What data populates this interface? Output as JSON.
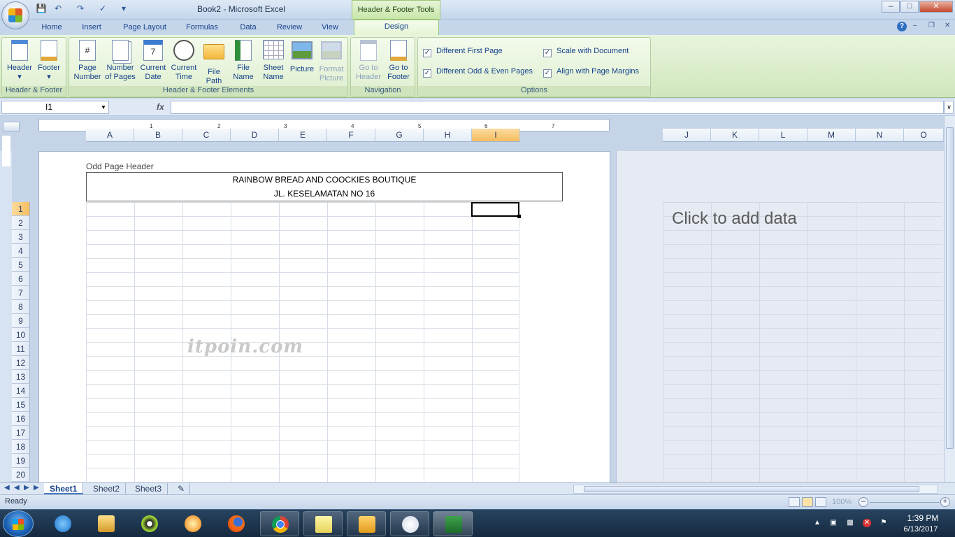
{
  "window": {
    "title": "Book2 - Microsoft Excel",
    "context_tab_title": "Header & Footer Tools"
  },
  "tabs": [
    "Home",
    "Insert",
    "Page Layout",
    "Formulas",
    "Data",
    "Review",
    "View",
    "Design"
  ],
  "active_tab": "Design",
  "ribbon": {
    "groups": {
      "hf": "Header & Footer",
      "elements": "Header & Footer Elements",
      "navigation": "Navigation",
      "options": "Options"
    },
    "buttons": {
      "header": "Header",
      "footer": "Footer",
      "page_number": [
        "Page",
        "Number"
      ],
      "number_of_pages": [
        "Number",
        "of Pages"
      ],
      "current_date": [
        "Current",
        "Date"
      ],
      "current_time": [
        "Current",
        "Time"
      ],
      "file_path": [
        "File",
        "Path"
      ],
      "file_name": [
        "File",
        "Name"
      ],
      "sheet_name": [
        "Sheet",
        "Name"
      ],
      "picture": "Picture",
      "format_picture": [
        "Format",
        "Picture"
      ],
      "go_to_header": [
        "Go to",
        "Header"
      ],
      "go_to_footer": [
        "Go to",
        "Footer"
      ]
    },
    "options": {
      "different_first_page": {
        "label": "Different First Page",
        "checked": true
      },
      "different_odd_even": {
        "label": "Different Odd & Even Pages",
        "checked": true
      },
      "scale_with_document": {
        "label": "Scale with Document",
        "checked": true
      },
      "align_with_margins": {
        "label": "Align with Page Margins",
        "checked": true
      }
    }
  },
  "formula_bar": {
    "name_box": "I1",
    "fx": "fx",
    "value": ""
  },
  "sheet": {
    "columns": [
      "A",
      "B",
      "C",
      "D",
      "E",
      "F",
      "G",
      "H",
      "I"
    ],
    "columns_page2": [
      "J",
      "K",
      "L",
      "M",
      "N",
      "O"
    ],
    "selected_column": "I",
    "rows": [
      "1",
      "2",
      "3",
      "4",
      "5",
      "6",
      "7",
      "8",
      "9",
      "10",
      "11",
      "12",
      "13",
      "14",
      "15",
      "16",
      "17",
      "18",
      "19",
      "20"
    ],
    "selected_row": "1",
    "ruler_marks": [
      "1",
      "2",
      "3",
      "4",
      "5",
      "6",
      "7"
    ],
    "header_label": "Odd Page Header",
    "header_line1": "RAINBOW BREAD AND COOCKIES BOUTIQUE",
    "header_line2": "JL. KESELAMATAN NO 16",
    "watermark": "itpoin.com",
    "click_to_add": "Click to add data"
  },
  "sheet_tabs": [
    "Sheet1",
    "Sheet2",
    "Sheet3"
  ],
  "active_sheet": "Sheet1",
  "status": {
    "text": "Ready",
    "zoom": "100%"
  },
  "taskbar": {
    "time": "1:39 PM",
    "date": "6/13/2017"
  }
}
